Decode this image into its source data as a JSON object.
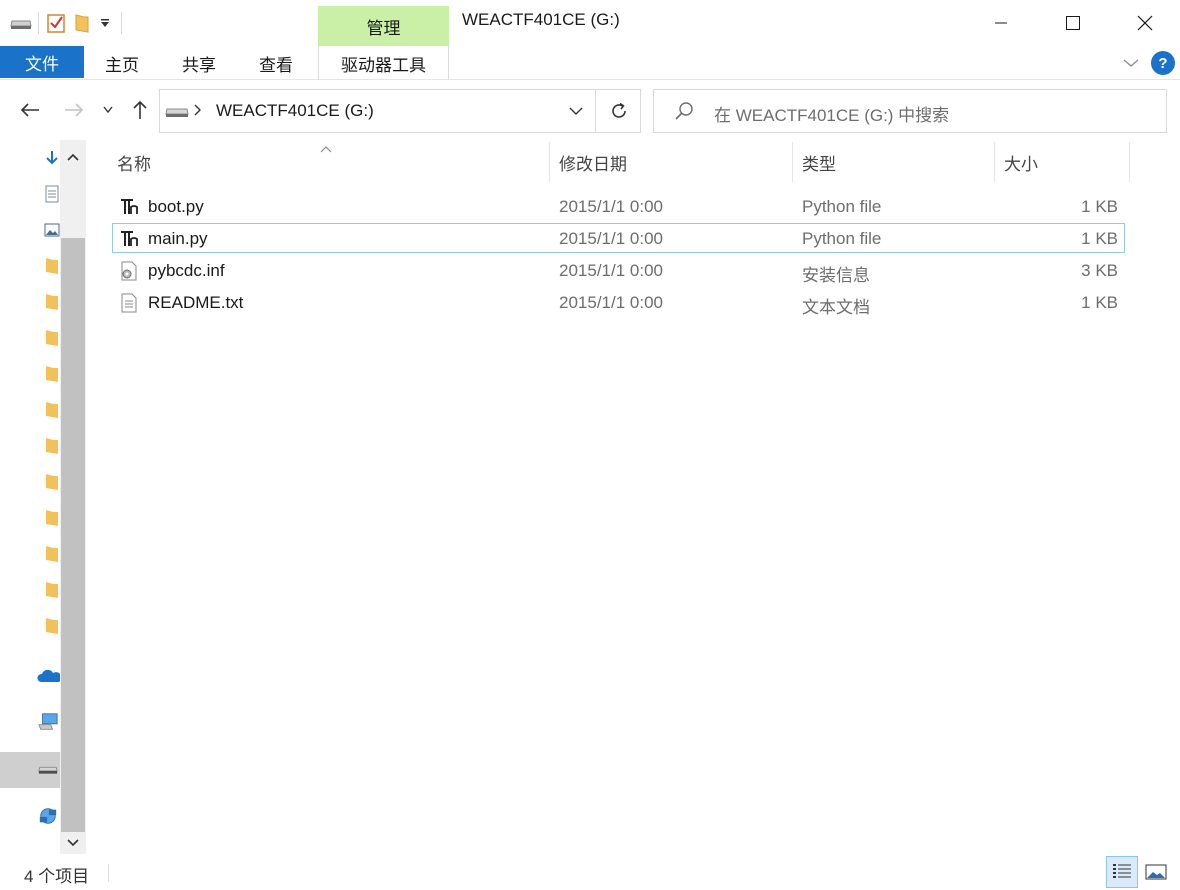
{
  "window": {
    "title": "WEACTF401CE (G:)",
    "context_tab_label": "管理"
  },
  "ribbon": {
    "file_label": "文件",
    "tabs": [
      "主页",
      "共享",
      "查看"
    ],
    "drive_tools_label": "驱动器工具",
    "help_label": "?"
  },
  "address": {
    "path": "WEACTF401CE (G:)",
    "search_placeholder": "在 WEACTF401CE (G:) 中搜索"
  },
  "columns": {
    "name": "名称",
    "date": "修改日期",
    "type": "类型",
    "size": "大小"
  },
  "files": [
    {
      "name": "boot.py",
      "date": "2015/1/1 0:00",
      "type": "Python file",
      "size": "1 KB",
      "icon": "python-file-icon"
    },
    {
      "name": "main.py",
      "date": "2015/1/1 0:00",
      "type": "Python file",
      "size": "1 KB",
      "icon": "python-file-icon"
    },
    {
      "name": "pybcdc.inf",
      "date": "2015/1/1 0:00",
      "type": "安装信息",
      "size": "3 KB",
      "icon": "setup-info-file-icon"
    },
    {
      "name": "README.txt",
      "date": "2015/1/1 0:00",
      "type": "文本文档",
      "size": "1 KB",
      "icon": "text-file-icon"
    }
  ],
  "status": {
    "item_count": "4 个项目"
  },
  "colors": {
    "file_tab": "#1a73c8",
    "context_tab": "#c9f0a6",
    "selection_border": "#99c6ee"
  }
}
